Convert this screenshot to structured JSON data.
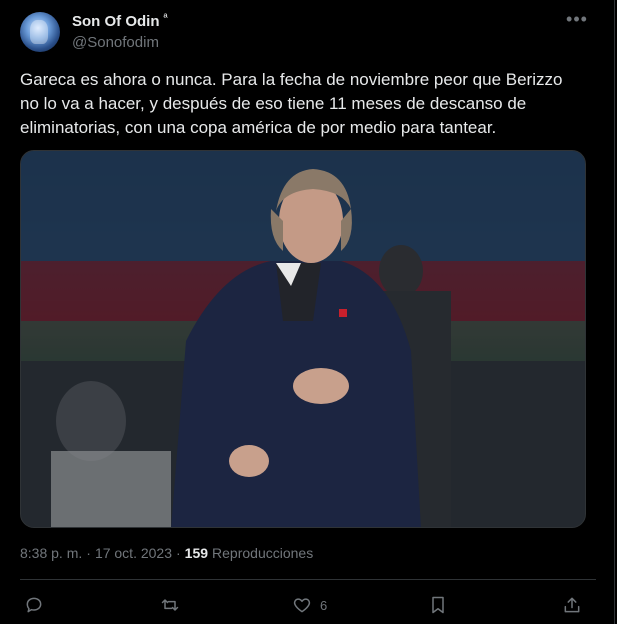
{
  "tweet": {
    "author_name": "Son Of Odin",
    "author_badge": "ª",
    "author_handle": "@Sonofodim",
    "text": "Gareca es ahora o nunca. Para la fecha de noviembre peor que Berizzo\nno lo va a hacer, y después de eso tiene 11 meses de descanso de\neliminatorias, con una copa américa de por medio para tantear.",
    "time": "8:38 p. m.",
    "separator": "·",
    "date": "17 oct. 2023",
    "views_count": "159",
    "views_label": "Reproducciones",
    "likes_count": "6"
  },
  "icons": [
    "avatar",
    "more-icon",
    "reply-icon",
    "retweet-icon",
    "like-icon",
    "bookmark-icon",
    "share-icon"
  ]
}
